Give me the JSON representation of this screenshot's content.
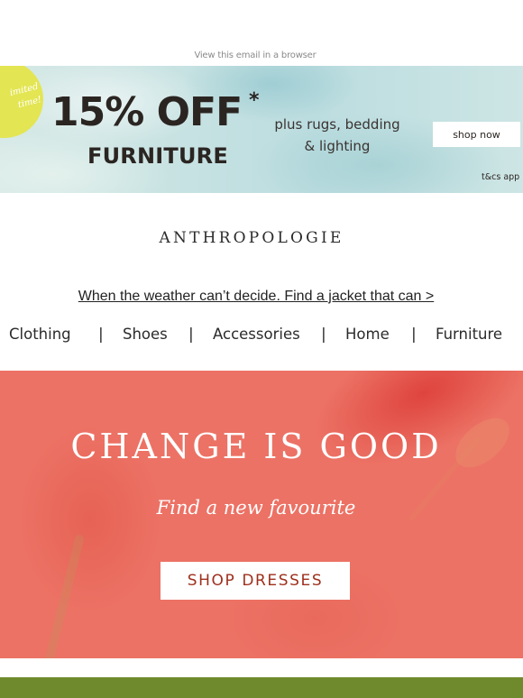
{
  "header": {
    "view_in_browser": "View this email in a browser"
  },
  "promo": {
    "badge_text": "imited\ntime!",
    "headline": "15% OFF",
    "asterisk": "*",
    "category": "FURNITURE",
    "sub_line1": "plus rugs, bedding",
    "sub_line2": "& lighting",
    "cta": "shop now",
    "terms": "t&cs app",
    "colors": {
      "badge": "#e3e552",
      "text": "#2b2522",
      "background": "#c7e2e2"
    }
  },
  "brand": {
    "logo": "ANTHROPOLOGIE"
  },
  "announcement": {
    "link_text": "When the weather can’t decide. Find a jacket that can >"
  },
  "nav": {
    "items": [
      {
        "label": "Clothing"
      },
      {
        "label": "Shoes"
      },
      {
        "label": "Accessories"
      },
      {
        "label": "Home"
      },
      {
        "label": "Furniture"
      }
    ],
    "separator": "|"
  },
  "hero": {
    "title": "CHANGE IS GOOD",
    "subtitle": "Find a new favourite",
    "cta": "SHOP DRESSES",
    "colors": {
      "background": "#ec7265",
      "cta_text": "#9e2f1c"
    }
  },
  "footer_strip": {
    "color": "#6f8a2c"
  }
}
